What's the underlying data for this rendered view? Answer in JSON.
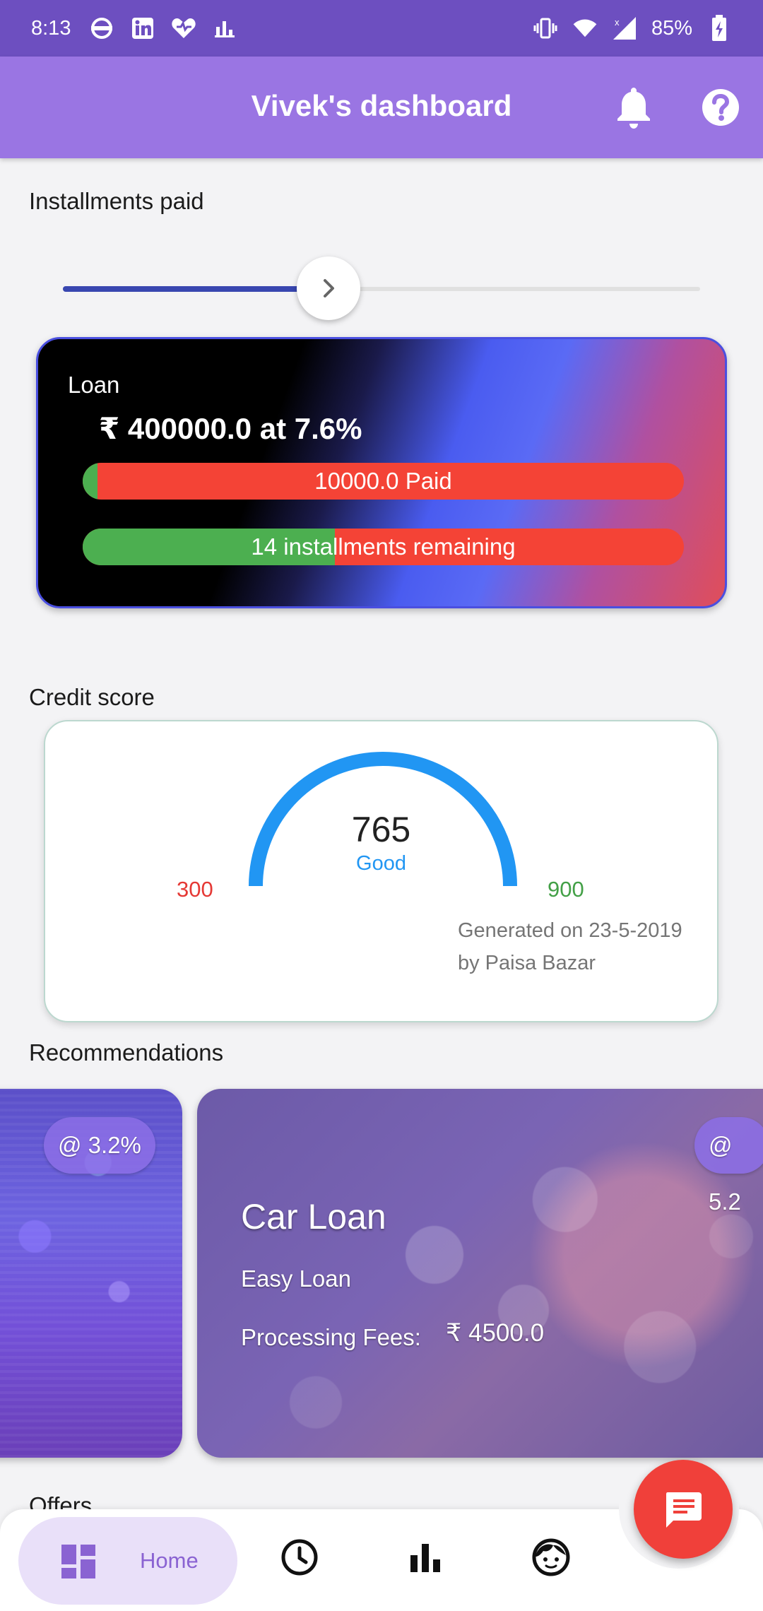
{
  "status_bar": {
    "time": "8:13",
    "battery": "85%"
  },
  "app_bar": {
    "title": "Vivek's dashboard"
  },
  "installments": {
    "label": "Installments paid",
    "slider_progress": 0.42
  },
  "loan": {
    "title": "Loan",
    "amount": "₹  400000.0 at 7.6%",
    "paid_label": "10000.0 Paid",
    "paid_fraction": 0.025,
    "remaining_label": "14 installments remaining",
    "remaining_fraction": 0.42
  },
  "credit": {
    "label": "Credit score",
    "score": "765",
    "rating": "Good",
    "min": "300",
    "max": "900",
    "generated_on": "Generated on 23-5-2019",
    "generated_by": "by Paisa Bazar",
    "colors": {
      "arc": "#2196f3",
      "min": "#e53935",
      "max": "#43a047"
    }
  },
  "recommendations": {
    "label": "Recommendations",
    "cards": [
      {
        "rate": "@ 3.2%"
      },
      {
        "rate": "@ 5.2",
        "name": "Car Loan",
        "type": "Easy Loan",
        "fees_label": "Processing Fees:",
        "fees_value": "₹ 4500.0"
      }
    ]
  },
  "offers": {
    "label": "Offers"
  },
  "bottom_nav": {
    "home_label": "Home",
    "items": [
      "dashboard-icon",
      "clock-icon",
      "bar-chart-icon",
      "face-icon"
    ]
  },
  "fab": {
    "icon": "chat-icon",
    "color": "#f0403a"
  }
}
